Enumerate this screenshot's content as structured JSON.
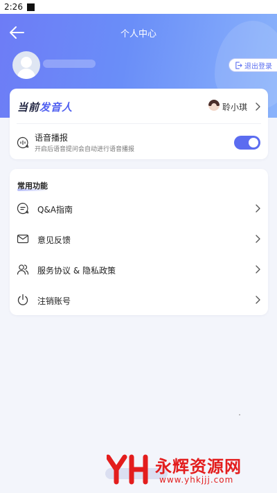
{
  "status_bar": {
    "time": "2:26"
  },
  "header": {
    "title": "个人中心",
    "logout_label": "退出登录"
  },
  "speaker": {
    "heading_part1": "当前",
    "heading_part2": "发音人",
    "name": "聆小琪"
  },
  "voice_broadcast": {
    "title": "语音播报",
    "description": "开启后语音提问会自动进行语音播报",
    "enabled": true
  },
  "common_functions": {
    "title": "常用功能",
    "items": [
      {
        "label": "Q&A指南",
        "icon": "chat-bubble-icon"
      },
      {
        "label": "意见反馈",
        "icon": "envelope-icon"
      },
      {
        "label": "服务协议 & 隐私政策",
        "icon": "users-icon"
      },
      {
        "label": "注销账号",
        "icon": "power-icon"
      }
    ]
  },
  "watermark": {
    "name": "永辉资源网",
    "url": "www.yhkjjj.com"
  },
  "colors": {
    "accent": "#5b6cf0",
    "header_start": "#6d7cf6",
    "header_end": "#8ab3fb",
    "watermark": "#e31d1d"
  }
}
